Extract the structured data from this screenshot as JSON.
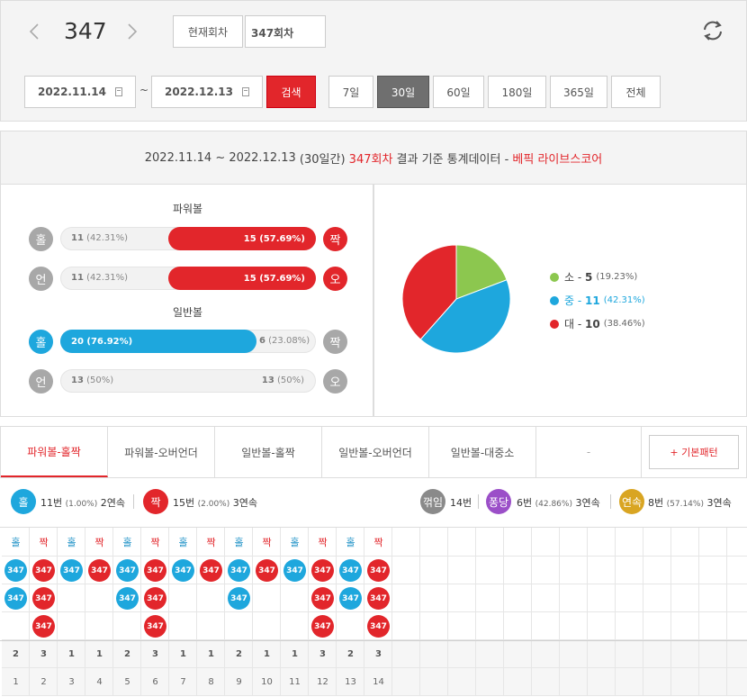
{
  "top": {
    "round": "347",
    "current_round_label": "현재회차",
    "round_input_value": "347회차",
    "date_from": "2022.11.14",
    "date_to": "2022.12.13",
    "tilde": "~",
    "search_label": "검색",
    "periods": [
      "7일",
      "30일",
      "60일",
      "180일",
      "365일",
      "전체"
    ],
    "active_period": "30일"
  },
  "header": {
    "range": "2022.11.14 ~ 2022.12.13",
    "days": "(30일간)",
    "round": "347회차",
    "mid": "결과 기준 통계데이터 -",
    "brand": "베픽 라이브스코어"
  },
  "powerball": {
    "title": "파워볼",
    "odd_even": {
      "left_label": "홀",
      "right_label": "짝",
      "left_count": "11",
      "left_pct": "(42.31%)",
      "right_count": "15",
      "right_pct": "(57.69%)",
      "right_fraction": 0.5769
    },
    "under_over": {
      "left_label": "언",
      "right_label": "오",
      "left_count": "11",
      "left_pct": "(42.31%)",
      "right_count": "15",
      "right_pct": "(57.69%)",
      "right_fraction": 0.5769
    }
  },
  "normalball": {
    "title": "일반볼",
    "odd_even": {
      "left_label": "홀",
      "right_label": "짝",
      "left_count": "20",
      "left_pct": "(76.92%)",
      "right_count": "6",
      "right_pct": "(23.08%)",
      "left_fraction": 0.7692
    },
    "under_over": {
      "left_label": "언",
      "right_label": "오",
      "left_count": "13",
      "left_pct": "(50%)",
      "right_count": "13",
      "right_pct": "(50%)"
    }
  },
  "pie": {
    "slices": [
      {
        "label": "소",
        "value": "5",
        "pct": "(19.23%)",
        "color": "#8cc74f",
        "frac": 0.1923
      },
      {
        "label": "중",
        "value": "11",
        "pct": "(42.31%)",
        "color": "#1ea7dd",
        "frac": 0.4231
      },
      {
        "label": "대",
        "value": "10",
        "pct": "(38.46%)",
        "color": "#e2262b",
        "frac": 0.3846
      }
    ]
  },
  "tabs": [
    "파워볼-홀짝",
    "파워볼-오버언더",
    "일반볼-홀짝",
    "일반볼-오버언더",
    "일반볼-대중소",
    "-"
  ],
  "pattern_button": "+ 기본패턴",
  "summary": {
    "odd": {
      "label": "홀",
      "count": "11번",
      "pct": "(1.00%)",
      "streak": "2연속"
    },
    "even": {
      "label": "짝",
      "count": "15번",
      "pct": "(2.00%)",
      "streak": "3연속"
    },
    "bend": {
      "label": "꺾임",
      "count": "14번"
    },
    "bounce": {
      "label": "퐁당",
      "count": "6번",
      "pct": "(42.86%)",
      "streak": "3연속"
    },
    "streak": {
      "label": "연속",
      "count": "8번",
      "pct": "(57.14%)",
      "streak": "3연속"
    }
  },
  "grid": {
    "columns": [
      {
        "head": "홀",
        "type": "odd",
        "balls": [
          "347",
          "347"
        ],
        "count": "2",
        "idx": "1"
      },
      {
        "head": "짝",
        "type": "even",
        "balls": [
          "347",
          "347",
          "347"
        ],
        "count": "3",
        "idx": "2"
      },
      {
        "head": "홀",
        "type": "odd",
        "balls": [
          "347"
        ],
        "count": "1",
        "idx": "3"
      },
      {
        "head": "짝",
        "type": "even",
        "balls": [
          "347"
        ],
        "count": "1",
        "idx": "4"
      },
      {
        "head": "홀",
        "type": "odd",
        "balls": [
          "347",
          "347"
        ],
        "count": "2",
        "idx": "5"
      },
      {
        "head": "짝",
        "type": "even",
        "balls": [
          "347",
          "347",
          "347"
        ],
        "count": "3",
        "idx": "6"
      },
      {
        "head": "홀",
        "type": "odd",
        "balls": [
          "347"
        ],
        "count": "1",
        "idx": "7"
      },
      {
        "head": "짝",
        "type": "even",
        "balls": [
          "347"
        ],
        "count": "1",
        "idx": "8"
      },
      {
        "head": "홀",
        "type": "odd",
        "balls": [
          "347",
          "347"
        ],
        "count": "2",
        "idx": "9"
      },
      {
        "head": "짝",
        "type": "even",
        "balls": [
          "347"
        ],
        "count": "1",
        "idx": "10"
      },
      {
        "head": "홀",
        "type": "odd",
        "balls": [
          "347"
        ],
        "count": "1",
        "idx": "11"
      },
      {
        "head": "짝",
        "type": "even",
        "balls": [
          "347",
          "347",
          "347"
        ],
        "count": "3",
        "idx": "12"
      },
      {
        "head": "홀",
        "type": "odd",
        "balls": [
          "347",
          "347"
        ],
        "count": "2",
        "idx": "13"
      },
      {
        "head": "짝",
        "type": "even",
        "balls": [
          "347",
          "347",
          "347"
        ],
        "count": "3",
        "idx": "14"
      }
    ],
    "total_columns": 27
  },
  "colors": {
    "red": "#e2262b",
    "blue": "#1ea7dd",
    "green": "#8cc74f",
    "gray": "#8a8a8a",
    "purple": "#9b4fc8",
    "gold": "#d9a522"
  }
}
